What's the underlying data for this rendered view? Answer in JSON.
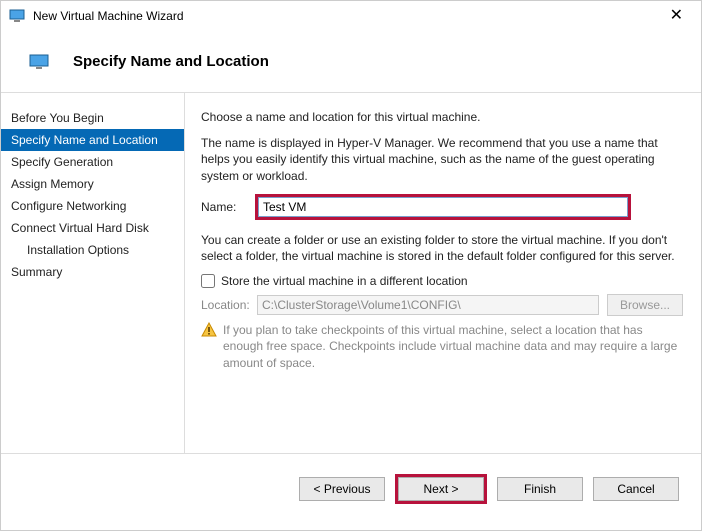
{
  "window": {
    "title": "New Virtual Machine Wizard"
  },
  "header": {
    "title": "Specify Name and Location"
  },
  "sidebar": {
    "items": [
      {
        "label": "Before You Begin"
      },
      {
        "label": "Specify Name and Location",
        "active": true
      },
      {
        "label": "Specify Generation"
      },
      {
        "label": "Assign Memory"
      },
      {
        "label": "Configure Networking"
      },
      {
        "label": "Connect Virtual Hard Disk"
      },
      {
        "label": "Installation Options",
        "sub": true
      },
      {
        "label": "Summary"
      }
    ]
  },
  "main": {
    "intro": "Choose a name and location for this virtual machine.",
    "desc": "The name is displayed in Hyper-V Manager. We recommend that you use a name that helps you easily identify this virtual machine, such as the name of the guest operating system or workload.",
    "name_label": "Name:",
    "name_value": "Test VM",
    "folder_desc": "You can create a folder or use an existing folder to store the virtual machine. If you don't select a folder, the virtual machine is stored in the default folder configured for this server.",
    "store_checkbox_label": "Store the virtual machine in a different location",
    "store_checked": false,
    "location_label": "Location:",
    "location_value": "C:\\ClusterStorage\\Volume1\\CONFIG\\",
    "browse_label": "Browse...",
    "warning": "If you plan to take checkpoints of this virtual machine, select a location that has enough free space. Checkpoints include virtual machine data and may require a large amount of space."
  },
  "footer": {
    "previous": "< Previous",
    "next": "Next >",
    "finish": "Finish",
    "cancel": "Cancel"
  }
}
